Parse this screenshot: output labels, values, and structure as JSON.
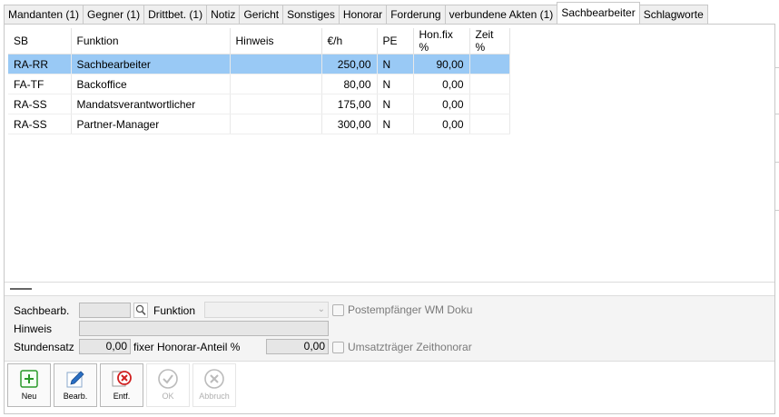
{
  "tabs": [
    {
      "label": "Mandanten (1)"
    },
    {
      "label": "Gegner (1)"
    },
    {
      "label": "Drittbet. (1)"
    },
    {
      "label": "Notiz"
    },
    {
      "label": "Gericht"
    },
    {
      "label": "Sonstiges"
    },
    {
      "label": "Honorar"
    },
    {
      "label": "Forderung"
    },
    {
      "label": "verbundene Akten (1)"
    },
    {
      "label": "Sachbearbeiter"
    },
    {
      "label": "Schlagworte"
    }
  ],
  "active_tab": "Sachbearbeiter",
  "table": {
    "columns": [
      "SB",
      "Funktion",
      "Hinweis",
      "€/h",
      "PE",
      "Hon.fix %",
      "Zeit %"
    ],
    "rows": [
      {
        "sb": "RA-RR",
        "funktion": "Sachbearbeiter",
        "hinweis": "",
        "rate": "250,00",
        "pe": "N",
        "honfix": "90,00",
        "zeit": ""
      },
      {
        "sb": "FA-TF",
        "funktion": "Backoffice",
        "hinweis": "",
        "rate": "80,00",
        "pe": "N",
        "honfix": "0,00",
        "zeit": ""
      },
      {
        "sb": "RA-SS",
        "funktion": "Mandatsverantwortlicher",
        "hinweis": "",
        "rate": "175,00",
        "pe": "N",
        "honfix": "0,00",
        "zeit": ""
      },
      {
        "sb": "RA-SS",
        "funktion": "Partner-Manager",
        "hinweis": "",
        "rate": "300,00",
        "pe": "N",
        "honfix": "0,00",
        "zeit": ""
      }
    ],
    "selected_row": 0
  },
  "form": {
    "sachbearb_label": "Sachbearb.",
    "funktion_label": "Funktion",
    "postempfaenger_label": "Postempfänger WM Doku",
    "hinweis_label": "Hinweis",
    "stundensatz_label": "Stundensatz",
    "stundensatz_value": "0,00",
    "fixer_label": "fixer Honorar-Anteil %",
    "fixer_value": "0,00",
    "umsatztraeger_label": "Umsatzträger Zeithonorar"
  },
  "toolbar": {
    "buttons": [
      {
        "label": "Neu",
        "icon": "add-icon",
        "enabled": true
      },
      {
        "label": "Bearb.",
        "icon": "edit-icon",
        "enabled": true
      },
      {
        "label": "Entf.",
        "icon": "delete-icon",
        "enabled": true
      },
      {
        "label": "OK",
        "icon": "check-icon",
        "enabled": false
      },
      {
        "label": "Abbruch",
        "icon": "cancel-icon",
        "enabled": false
      }
    ]
  },
  "colors": {
    "selection": "#99c9f5",
    "add": "#2a9a2a",
    "edit": "#2a6fc4",
    "delete": "#d02020",
    "disabled": "#b0b0b0"
  }
}
